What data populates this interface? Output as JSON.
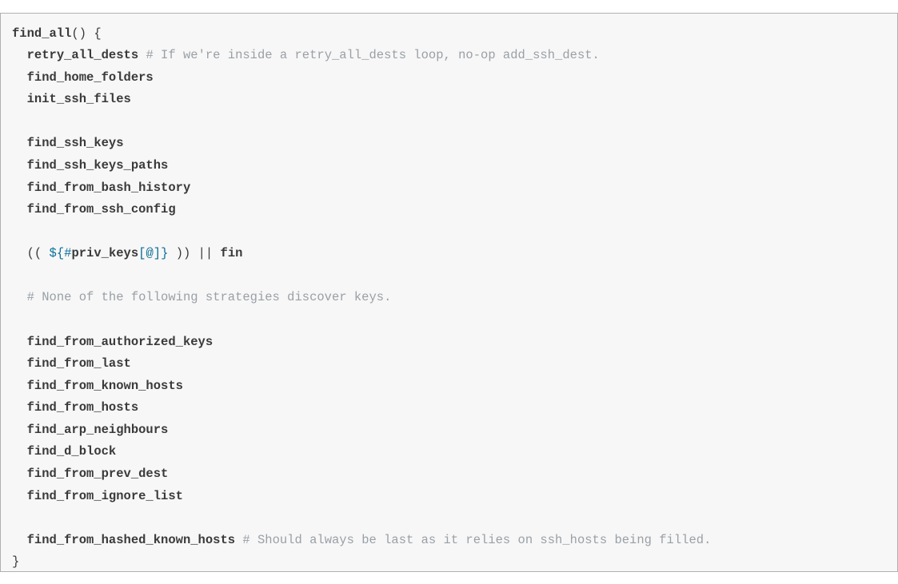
{
  "code": {
    "fn_decl": "find_all",
    "open_brace": "() {",
    "close_brace": "}",
    "indent": "  ",
    "calls": {
      "retry_all_dests": "retry_all_dests",
      "find_home_folders": "find_home_folders",
      "init_ssh_files": "init_ssh_files",
      "find_ssh_keys": "find_ssh_keys",
      "find_ssh_keys_paths": "find_ssh_keys_paths",
      "find_from_bash_history": "find_from_bash_history",
      "find_from_ssh_config": "find_from_ssh_config",
      "find_from_authorized_keys": "find_from_authorized_keys",
      "find_from_last": "find_from_last",
      "find_from_known_hosts": "find_from_known_hosts",
      "find_from_hosts": "find_from_hosts",
      "find_arp_neighbours": "find_arp_neighbours",
      "find_d_block": "find_d_block",
      "find_from_prev_dest": "find_from_prev_dest",
      "find_from_ignore_list": "find_from_ignore_list",
      "find_from_hashed_known_hosts": "find_from_hashed_known_hosts"
    },
    "expr": {
      "open": "(( ",
      "dollar_open": "${",
      "hash": "#",
      "var": "priv_keys",
      "sub_open": "[",
      "at": "@",
      "sub_close": "]",
      "brace_close": "}",
      "close": " )) ",
      "or": "|| ",
      "fin": "fin"
    },
    "comments": {
      "c1": "# If we're inside a retry_all_dests loop, no-op add_ssh_dest.",
      "c2": "# None of the following strategies discover keys.",
      "c3": "# Should always be last as it relies on ssh_hosts being filled."
    }
  }
}
